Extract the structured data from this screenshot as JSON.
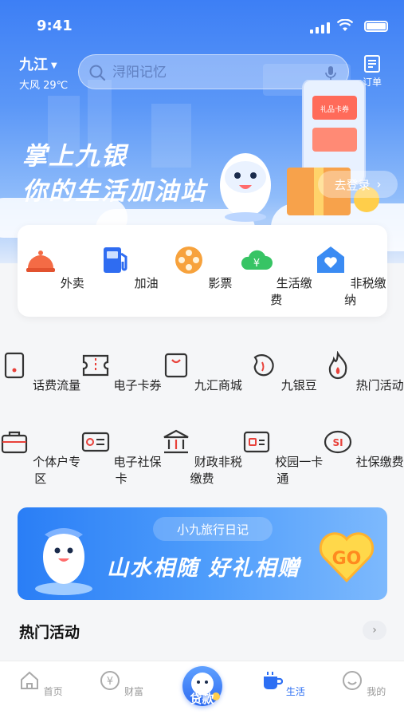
{
  "status_bar": {
    "time": "9:41"
  },
  "header": {
    "city": "九江",
    "weather": "大风 29℃",
    "search_placeholder": "浔阳记忆",
    "order_label": "订单"
  },
  "hero": {
    "slogan_line1": "掌上九银",
    "slogan_line2": "你的生活加油站",
    "login_label": "去登录",
    "gift_card_text": "礼品卡券"
  },
  "quick_services": [
    {
      "label": "外卖",
      "icon": "food-bell-icon"
    },
    {
      "label": "加油",
      "icon": "fuel-pump-icon"
    },
    {
      "label": "影票",
      "icon": "film-reel-icon"
    },
    {
      "label": "生活缴费",
      "icon": "utility-cloud-icon"
    },
    {
      "label": "非税缴纳",
      "icon": "house-heart-icon"
    }
  ],
  "services_row1": [
    {
      "label": "话费流量",
      "icon": "phone-icon"
    },
    {
      "label": "电子卡券",
      "icon": "ticket-icon"
    },
    {
      "label": "九汇商城",
      "icon": "shopping-bag-icon"
    },
    {
      "label": "九银豆",
      "icon": "bean-icon"
    },
    {
      "label": "热门活动",
      "icon": "flame-icon"
    }
  ],
  "services_row2": [
    {
      "label": "个体户专区",
      "icon": "briefcase-icon"
    },
    {
      "label": "电子社保卡",
      "icon": "id-card-icon"
    },
    {
      "label": "财政非税缴费",
      "icon": "government-building-icon"
    },
    {
      "label": "校园一卡通",
      "icon": "campus-card-icon"
    },
    {
      "label": "社保缴费",
      "icon": "social-security-icon"
    }
  ],
  "banner": {
    "tag": "小九旅行日记",
    "headline": "山水相随 好礼相赠",
    "go_label": "GO"
  },
  "hot_section": {
    "title": "热门活动",
    "more": "›"
  },
  "tabbar": [
    {
      "label": "首页",
      "icon": "home-icon"
    },
    {
      "label": "财富",
      "icon": "wealth-icon"
    },
    {
      "label": "贷款",
      "icon": "loan-mascot-icon"
    },
    {
      "label": "生活",
      "icon": "life-cup-icon"
    },
    {
      "label": "我的",
      "icon": "profile-icon"
    }
  ],
  "colors": {
    "primary": "#2d6ff3",
    "accent_red": "#e8413a",
    "orange": "#f5a623"
  }
}
